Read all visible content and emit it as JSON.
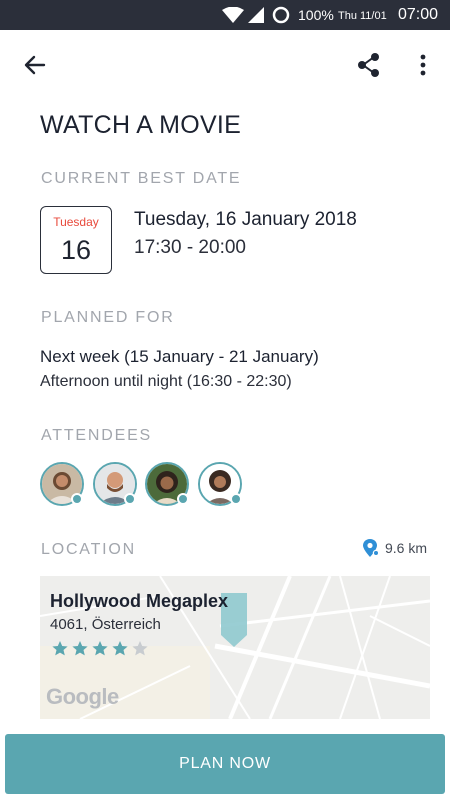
{
  "status_bar": {
    "battery": "100%",
    "date": "Thu 11/01",
    "time": "07:00"
  },
  "app_bar": {
    "icons": [
      "arrow-back-icon",
      "share-icon",
      "more-vert-icon"
    ]
  },
  "event": {
    "title": "WATCH A MOVIE"
  },
  "best_date": {
    "section_label": "CURRENT BEST DATE",
    "calendar_weekday": "Tuesday",
    "calendar_day": "16",
    "date_text": "Tuesday, 16 January 2018",
    "time_text": "17:30 - 20:00"
  },
  "planned": {
    "section_label": "PLANNED FOR",
    "range_text": "Next week (15 January - 21 January)",
    "time_text": "Afternoon until night (16:30 - 22:30)"
  },
  "attendees": {
    "section_label": "ATTENDEES",
    "count": 4
  },
  "location": {
    "section_label": "LOCATION",
    "distance": "9.6 km",
    "venue_name": "Hollywood Megaplex",
    "venue_address": "4061, Österreich",
    "rating": 4,
    "rating_max": 5,
    "map_attribution": "Google"
  },
  "actions": {
    "plan_now": "PLAN NOW"
  },
  "colors": {
    "accent": "#5aa6b0",
    "calendar_weekday": "#e84a3c",
    "status_bar": "#2b2f3a",
    "star_empty": "#c8ccd0"
  }
}
